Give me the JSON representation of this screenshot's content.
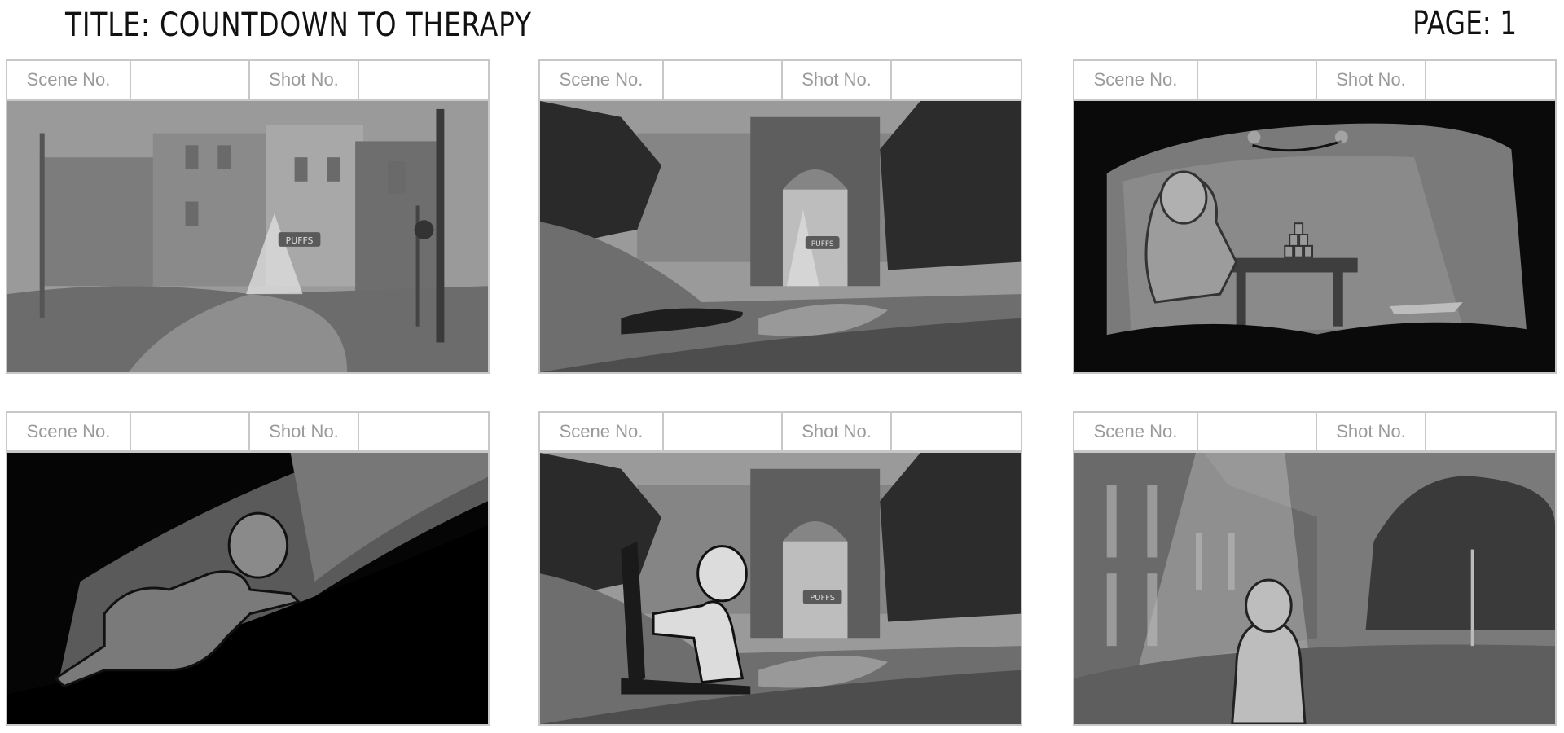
{
  "header": {
    "title": "TITLE: COUNTDOWN TO THERAPY",
    "page": "PAGE: 1"
  },
  "panel_labels": {
    "scene": "Scene No.",
    "shot": "Shot No."
  },
  "sign_text": "PUFFS",
  "colors": {
    "border": "#c8c8c8",
    "label": "#9a9a9a"
  }
}
